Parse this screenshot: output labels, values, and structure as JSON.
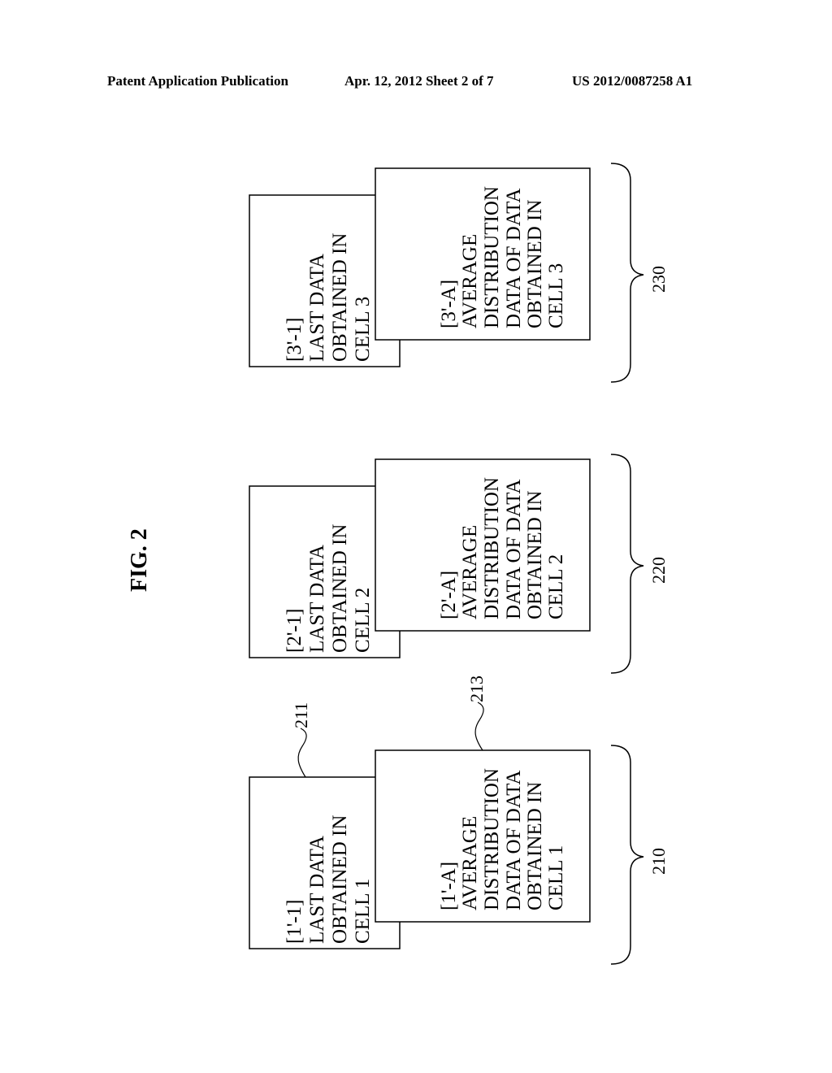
{
  "header": {
    "left": "Patent Application Publication",
    "center": "Apr. 12, 2012  Sheet 2 of 7",
    "right": "US 2012/0087258 A1"
  },
  "figure_label": "FIG. 2",
  "groups": [
    {
      "ref": "230",
      "last_box": [
        "[3'-1]",
        "LAST DATA",
        "OBTAINED IN",
        "CELL 3"
      ],
      "avg_box": [
        "[3'-A]",
        "AVERAGE",
        "DISTRIBUTION",
        "DATA OF DATA",
        "OBTAINED IN",
        "CELL 3"
      ]
    },
    {
      "ref": "220",
      "last_box": [
        "[2'-1]",
        "LAST DATA",
        "OBTAINED IN",
        "CELL 2"
      ],
      "avg_box": [
        "[2'-A]",
        "AVERAGE",
        "DISTRIBUTION",
        "DATA OF DATA",
        "OBTAINED IN",
        "CELL 2"
      ]
    },
    {
      "ref": "210",
      "last_box": [
        "[1'-1]",
        "LAST DATA",
        "OBTAINED IN",
        "CELL 1"
      ],
      "avg_box": [
        "[1'-A]",
        "AVERAGE",
        "DISTRIBUTION",
        "DATA OF DATA",
        "OBTAINED IN",
        "CELL 1"
      ],
      "last_box_ref": "211",
      "avg_box_ref": "213"
    }
  ]
}
